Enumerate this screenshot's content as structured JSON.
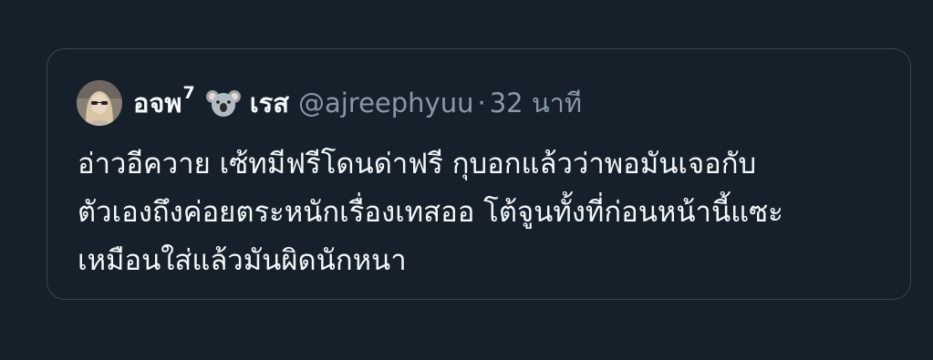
{
  "tweet": {
    "display_name": "อจพ",
    "name_superscript": "7",
    "name_emoji": "koala-icon",
    "name_suffix": "เรส",
    "handle": "@ajreephyuu",
    "separator": "·",
    "time": "32 นาที",
    "text": "อ่าวอีควาย เซ้ทมีฟรีโดนด่าฟรี กุบอกแล้วว่าพอมันเจอกับ\nตัวเองถึงค่อยตระหนักเรื่องเทสออ โต้จูนทั้งที่ก่อนหน้านี้แซะ\nเหมือนใส่แล้วมันผิดนักหนา"
  },
  "colors": {
    "background": "#15202b",
    "border": "#38444d",
    "text_primary": "#f5f8fa",
    "text_secondary": "#8899a6"
  }
}
